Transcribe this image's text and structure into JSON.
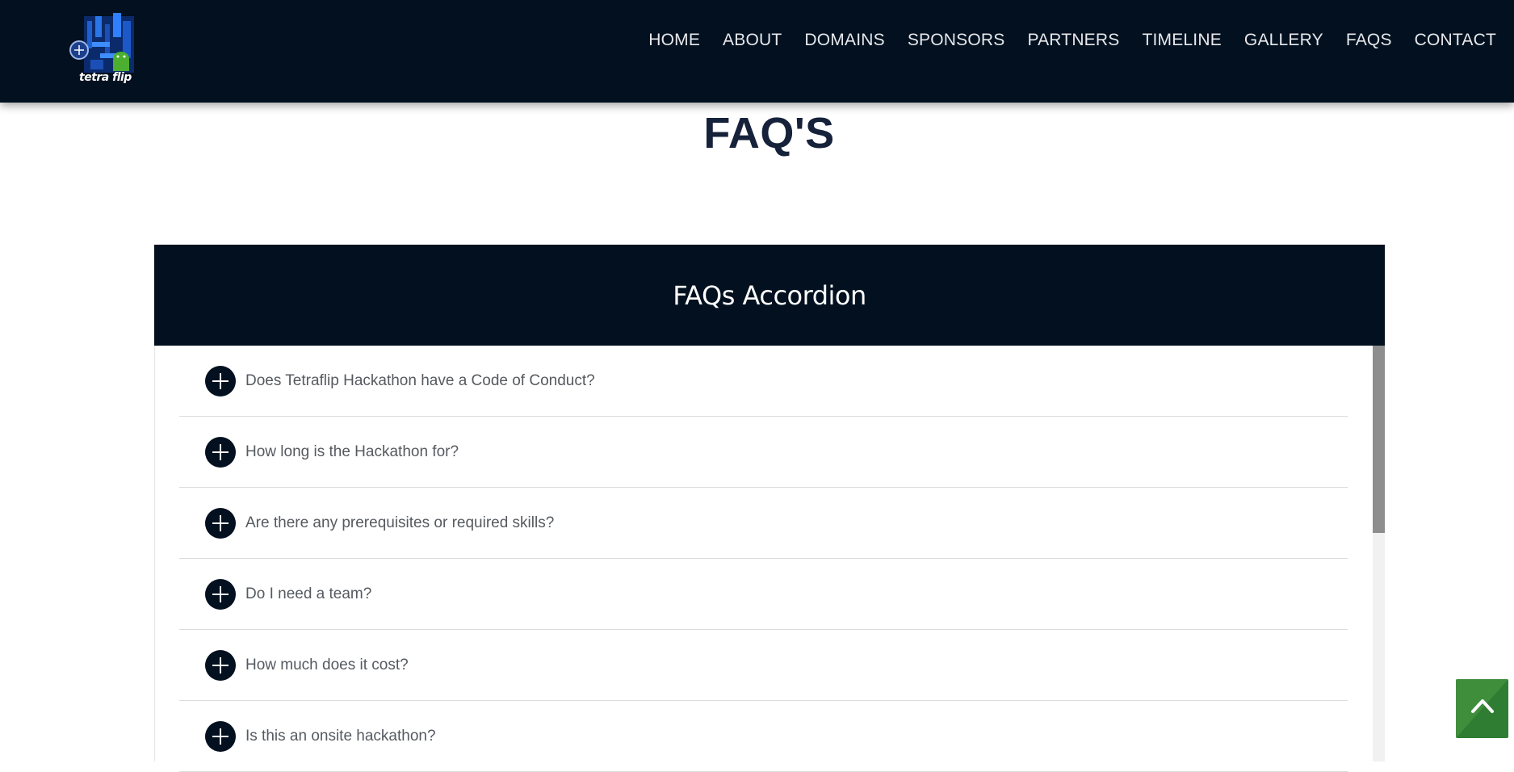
{
  "header": {
    "logo_text": "tetra flip",
    "nav": [
      "HOME",
      "ABOUT",
      "DOMAINS",
      "SPONSORS",
      "PARTNERS",
      "TIMELINE",
      "GALLERY",
      "FAQS",
      "CONTACT"
    ]
  },
  "page": {
    "title": "FAQ'S"
  },
  "faq": {
    "heading": "FAQs Accordion",
    "items": [
      {
        "question": "Does Tetraflip Hackathon have a Code of Conduct?"
      },
      {
        "question": "How long is the Hackathon for?"
      },
      {
        "question": "Are there any prerequisites or required skills?"
      },
      {
        "question": "Do I need a team?"
      },
      {
        "question": "How much does it cost?"
      },
      {
        "question": "Is this an onsite hackathon?"
      }
    ],
    "scroll_position": 0
  },
  "icons": {
    "expand": "plus-circle-icon",
    "back_to_top": "chevron-up-icon"
  },
  "colors": {
    "navbar_bg": "#02101f",
    "title": "#16213a",
    "back_to_top": "#2f7d32"
  }
}
